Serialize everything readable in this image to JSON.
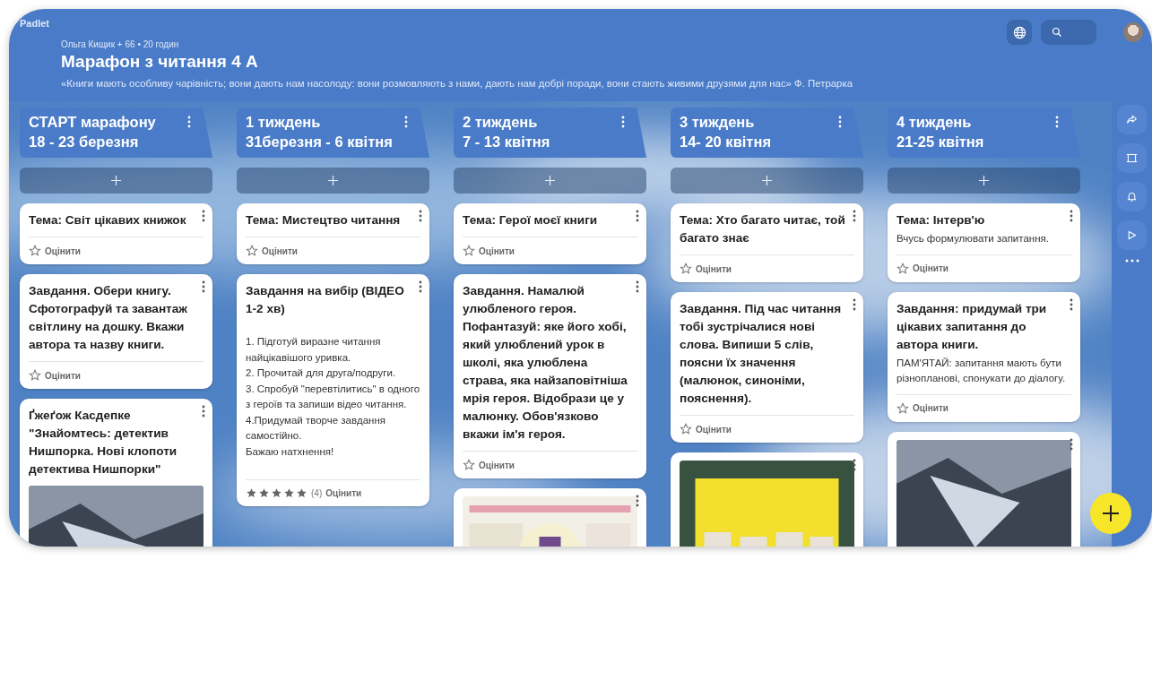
{
  "app": {
    "logo": "Padlet"
  },
  "header": {
    "byline": "Ольга Кищик + 66 • 20 годин",
    "title": "Марафон з читання 4 А",
    "description": "«Книги мають особливу чарівність; вони дають нам насолоду: вони розмовляють з нами, дають нам добрі поради, вони стають живими друзями для нас» Ф. Петрарка"
  },
  "columns": [
    {
      "title": [
        "СТАРТ марафону",
        "18 - 23 березня"
      ],
      "posts": [
        {
          "kind": "text",
          "title": "Тема: Світ цікавих книжок",
          "rating": {
            "label": "Оцінити"
          }
        },
        {
          "kind": "text",
          "title": "Завдання. Обери книгу. Сфотографуй та завантаж світлину на дошку. Вкажи автора та назву книги.",
          "rating": {
            "label": "Оцінити"
          }
        },
        {
          "kind": "media",
          "title": "Ґжеґож Касдепке \"Знайомтесь: детектив Нишпорка. Нові клопоти детектива Нишпорки\""
        }
      ]
    },
    {
      "title": [
        "1 тиждень",
        "31березня - 6 квітня"
      ],
      "posts": [
        {
          "kind": "text",
          "title": "Тема: Мистецтво читання",
          "rating": {
            "label": "Оцінити"
          }
        },
        {
          "kind": "text",
          "title": "Завдання на вибір (ВІДЕО 1-2 хв)",
          "body": [
            "1. Підготуй  виразне читання найцікавішого уривка.",
            "2. Прочитай  для  друга/подруги.",
            "3. Спробуй \"перевтілитись\" в одного з героїв та запиши відео читання.",
            "4.Придумай творче завдання самостійно.",
            "Бажаю натхнення!"
          ],
          "rating": {
            "stars": 5,
            "count": "(4)",
            "label": "Оцінити"
          }
        }
      ]
    },
    {
      "title": [
        "2 тиждень",
        "7 - 13 квітня"
      ],
      "posts": [
        {
          "kind": "text",
          "title": "Тема: Герої моєї книги",
          "rating": {
            "label": "Оцінити"
          }
        },
        {
          "kind": "text",
          "title": "Завдання. Намалюй улюбленого героя. Пофантазуй: яке його хобі, який улюблений урок в школі, яка улюблена страва, яка найзаповітніша мрія героя. Відобрази це у малюнку. Обов'язково вкажи ім'я героя.",
          "rating": {
            "label": "Оцінити"
          }
        },
        {
          "kind": "media"
        }
      ]
    },
    {
      "title": [
        "3 тиждень",
        "14- 20 квітня"
      ],
      "posts": [
        {
          "kind": "text",
          "title": "Тема: Хто багато читає, той багато знає",
          "rating": {
            "label": "Оцінити"
          }
        },
        {
          "kind": "text",
          "title": "Завдання. Під час читання тобі зустрічалися нові слова. Випиши 5 слів, поясни їх значення (малюнок, синоніми, пояснення).",
          "rating": {
            "label": "Оцінити"
          }
        },
        {
          "kind": "media"
        }
      ]
    },
    {
      "title": [
        "4 тиждень",
        "21-25 квітня"
      ],
      "posts": [
        {
          "kind": "text",
          "title": "Тема: Інтерв'ю",
          "body": [
            "Вчусь формулювати запитання."
          ],
          "rating": {
            "label": "Оцінити"
          }
        },
        {
          "kind": "text",
          "title": "Завдання: придумай три цікавих запитання до автора книги.",
          "body": [
            "ПАМ'ЯТАЙ: запитання мають бути різнопланові, спонукати до діалогу."
          ],
          "rating": {
            "label": "Оцінити"
          }
        },
        {
          "kind": "media"
        }
      ]
    }
  ]
}
